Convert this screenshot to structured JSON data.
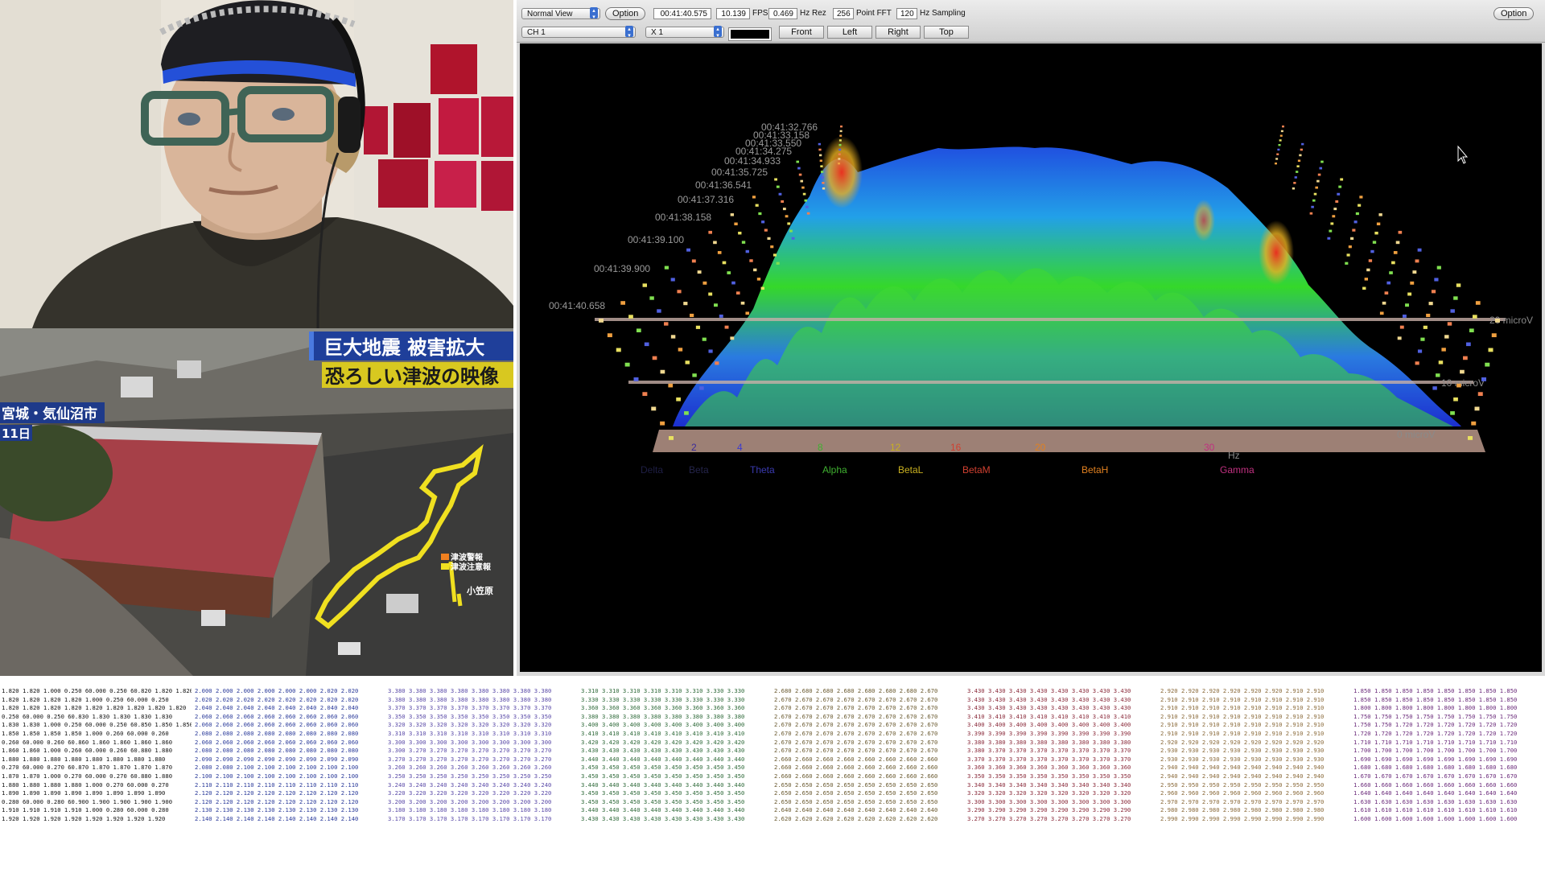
{
  "toolbar": {
    "view_select": "Normal View",
    "option_left": "Option",
    "time_value": "00:41:40.575",
    "fps_value": "10.139",
    "fps_label": "FPS",
    "hzrez_value": "0.469",
    "hzrez_label": "Hz Rez",
    "fft_value": "256",
    "fft_label": "Point FFT",
    "sampling_value": "120",
    "sampling_label": "Hz Sampling",
    "option_right": "Option",
    "channel_select": "CH 1",
    "scale_select": "X 1",
    "view_buttons": [
      "Front",
      "Left",
      "Right",
      "Top"
    ]
  },
  "plot": {
    "timestamps": [
      "00:41:40.658",
      "00:41:39.900",
      "00:41:39.100",
      "00:41:38.158",
      "00:41:37.316",
      "00:41:36.541",
      "00:41:35.725",
      "00:41:34.933",
      "00:41:34.275",
      "00:41:33.550",
      "00:41:33.158",
      "00:41:32.766"
    ],
    "amplitude_labels": [
      "20 microV",
      "10 microV",
      "0 microV"
    ],
    "freq_ticks": [
      "2",
      "4",
      "8",
      "12",
      "16",
      "20",
      "30"
    ],
    "hz_label": "Hz",
    "bands": [
      "Delta",
      "Beta",
      "Theta",
      "Alpha",
      "BetaL",
      "BetaM",
      "BetaH",
      "Gamma"
    ],
    "colors": {
      "surface_low": "#1a3fd8",
      "surface_mid": "#33dd22",
      "surface_high": "#e8221a"
    }
  },
  "tv": {
    "headline1": "巨大地震 被害拡大",
    "headline2": "恐ろしい津波の映像",
    "location": "宮城・気仙沼市",
    "date": "11日",
    "legend1": "津波警報",
    "legend2": "津波注意報",
    "map_label": "小笠原"
  },
  "data_table": {
    "columns": [
      {
        "color": "#111111",
        "rows": [
          "1.820 1.820 1.000 0.250 60.000 0.250 60.820 1.820 1.820",
          "1.820 1.820 1.820 1.820 1.000 0.250 60.000 0.250",
          "1.820 1.820 1.820 1.820 1.820 1.820 1.820 1.820 1.820",
          "0.250 60.000 0.250 60.830 1.830 1.830 1.830 1.830",
          "1.830 1.830 1.000 0.250 60.000 0.250 60.850 1.850 1.850",
          "1.850 1.850 1.850 1.850 1.000 0.260 60.000 0.260",
          "0.260 60.000 0.260 60.860 1.860 1.860 1.860 1.860",
          "1.860 1.860 1.000 0.260 60.000 0.260 60.880 1.880",
          "1.880 1.880 1.880 1.880 1.880 1.880 1.880 1.880",
          "0.270 60.000 0.270 60.870 1.870 1.870 1.870 1.870",
          "1.870 1.870 1.000 0.270 60.000 0.270 60.880 1.880",
          "1.880 1.880 1.880 1.880 1.000 0.270 60.000 0.270",
          "1.890 1.890 1.890 1.890 1.890 1.890 1.890 1.890",
          "0.280 60.000 0.280 60.900 1.900 1.900 1.900 1.900",
          "1.910 1.910 1.910 1.910 1.000 0.280 60.000 0.280",
          "1.920 1.920 1.920 1.920 1.920 1.920 1.920 1.920"
        ]
      },
      {
        "color": "#2a3a9a",
        "rows": [
          "2.000 2.000 2.000 2.000 2.000 2.000 2.020 2.020",
          "2.020 2.020 2.020 2.020 2.020 2.020 2.020 2.020",
          "2.040 2.040 2.040 2.040 2.040 2.040 2.040 2.040",
          "2.060 2.060 2.060 2.060 2.060 2.060 2.060 2.060",
          "2.060 2.060 2.060 2.060 2.060 2.060 2.060 2.060",
          "2.080 2.080 2.080 2.080 2.080 2.080 2.080 2.080",
          "2.060 2.060 2.060 2.060 2.060 2.060 2.060 2.060",
          "2.080 2.080 2.080 2.080 2.080 2.080 2.080 2.080",
          "2.090 2.090 2.090 2.090 2.090 2.090 2.090 2.090",
          "2.080 2.080 2.100 2.100 2.100 2.100 2.100 2.100",
          "2.100 2.100 2.100 2.100 2.100 2.100 2.100 2.100",
          "2.110 2.110 2.110 2.110 2.110 2.110 2.110 2.110",
          "2.120 2.120 2.120 2.120 2.120 2.120 2.120 2.120",
          "2.120 2.120 2.120 2.120 2.120 2.120 2.120 2.120",
          "2.130 2.130 2.130 2.130 2.130 2.130 2.130 2.130",
          "2.140 2.140 2.140 2.140 2.140 2.140 2.140 2.140"
        ]
      },
      {
        "color": "#5a4aa8",
        "rows": [
          "3.380 3.380 3.380 3.380 3.380 3.380 3.380 3.380",
          "3.380 3.380 3.380 3.380 3.380 3.380 3.380 3.380",
          "3.370 3.370 3.370 3.370 3.370 3.370 3.370 3.370",
          "3.350 3.350 3.350 3.350 3.350 3.350 3.350 3.350",
          "3.320 3.320 3.320 3.320 3.320 3.320 3.320 3.320",
          "3.310 3.310 3.310 3.310 3.310 3.310 3.310 3.310",
          "3.300 3.300 3.300 3.300 3.300 3.300 3.300 3.300",
          "3.300 3.270 3.270 3.270 3.270 3.270 3.270 3.270",
          "3.270 3.270 3.270 3.270 3.270 3.270 3.270 3.270",
          "3.260 3.260 3.260 3.260 3.260 3.260 3.260 3.260",
          "3.250 3.250 3.250 3.250 3.250 3.250 3.250 3.250",
          "3.240 3.240 3.240 3.240 3.240 3.240 3.240 3.240",
          "3.220 3.220 3.220 3.220 3.220 3.220 3.220 3.220",
          "3.200 3.200 3.200 3.200 3.200 3.200 3.200 3.200",
          "3.180 3.180 3.180 3.180 3.180 3.180 3.180 3.180",
          "3.170 3.170 3.170 3.170 3.170 3.170 3.170 3.170"
        ]
      },
      {
        "color": "#2f6a3a",
        "rows": [
          "3.310 3.310 3.310 3.310 3.310 3.310 3.330 3.330",
          "3.330 3.330 3.330 3.330 3.330 3.330 3.330 3.330",
          "3.360 3.360 3.360 3.360 3.360 3.360 3.360 3.360",
          "3.380 3.380 3.380 3.380 3.380 3.380 3.380 3.380",
          "3.400 3.400 3.400 3.400 3.400 3.400 3.400 3.400",
          "3.410 3.410 3.410 3.410 3.410 3.410 3.410 3.410",
          "3.420 3.420 3.420 3.420 3.420 3.420 3.420 3.420",
          "3.430 3.430 3.430 3.430 3.430 3.430 3.430 3.430",
          "3.440 3.440 3.440 3.440 3.440 3.440 3.440 3.440",
          "3.450 3.450 3.450 3.450 3.450 3.450 3.450 3.450",
          "3.450 3.450 3.450 3.450 3.450 3.450 3.450 3.450",
          "3.440 3.440 3.440 3.440 3.440 3.440 3.440 3.440",
          "3.450 3.450 3.450 3.450 3.450 3.450 3.450 3.450",
          "3.450 3.450 3.450 3.450 3.450 3.450 3.450 3.450",
          "3.440 3.440 3.440 3.440 3.440 3.440 3.440 3.440",
          "3.430 3.430 3.430 3.430 3.430 3.430 3.430 3.430"
        ]
      },
      {
        "color": "#6a5a30",
        "rows": [
          "2.680 2.680 2.680 2.680 2.680 2.680 2.680 2.670",
          "2.670 2.670 2.670 2.670 2.670 2.670 2.670 2.670",
          "2.670 2.670 2.670 2.670 2.670 2.670 2.670 2.670",
          "2.670 2.670 2.670 2.670 2.670 2.670 2.670 2.670",
          "2.670 2.670 2.670 2.670 2.670 2.670 2.670 2.670",
          "2.670 2.670 2.670 2.670 2.670 2.670 2.670 2.670",
          "2.670 2.670 2.670 2.670 2.670 2.670 2.670 2.670",
          "2.670 2.670 2.670 2.670 2.670 2.670 2.670 2.670",
          "2.660 2.660 2.660 2.660 2.660 2.660 2.660 2.660",
          "2.660 2.660 2.660 2.660 2.660 2.660 2.660 2.660",
          "2.660 2.660 2.660 2.660 2.660 2.660 2.660 2.660",
          "2.650 2.650 2.650 2.650 2.650 2.650 2.650 2.650",
          "2.650 2.650 2.650 2.650 2.650 2.650 2.650 2.650",
          "2.650 2.650 2.650 2.650 2.650 2.650 2.650 2.650",
          "2.640 2.640 2.640 2.640 2.640 2.640 2.640 2.640",
          "2.620 2.620 2.620 2.620 2.620 2.620 2.620 2.620"
        ]
      },
      {
        "color": "#8a2a3a",
        "rows": [
          "3.430 3.430 3.430 3.430 3.430 3.430 3.430 3.430",
          "3.430 3.430 3.430 3.430 3.430 3.430 3.430 3.430",
          "3.430 3.430 3.430 3.430 3.430 3.430 3.430 3.430",
          "3.410 3.410 3.410 3.410 3.410 3.410 3.410 3.410",
          "3.400 3.400 3.400 3.400 3.400 3.400 3.400 3.400",
          "3.390 3.390 3.390 3.390 3.390 3.390 3.390 3.390",
          "3.380 3.380 3.380 3.380 3.380 3.380 3.380 3.380",
          "3.380 3.370 3.370 3.370 3.370 3.370 3.370 3.370",
          "3.370 3.370 3.370 3.370 3.370 3.370 3.370 3.370",
          "3.360 3.360 3.360 3.360 3.360 3.360 3.360 3.360",
          "3.350 3.350 3.350 3.350 3.350 3.350 3.350 3.350",
          "3.340 3.340 3.340 3.340 3.340 3.340 3.340 3.340",
          "3.320 3.320 3.320 3.320 3.320 3.320 3.320 3.320",
          "3.300 3.300 3.300 3.300 3.300 3.300 3.300 3.300",
          "3.290 3.290 3.290 3.290 3.290 3.290 3.290 3.290",
          "3.270 3.270 3.270 3.270 3.270 3.270 3.270 3.270"
        ]
      },
      {
        "color": "#8a6a3a",
        "rows": [
          "2.920 2.920 2.920 2.920 2.920 2.920 2.910 2.910",
          "2.910 2.910 2.910 2.910 2.910 2.910 2.910 2.910",
          "2.910 2.910 2.910 2.910 2.910 2.910 2.910 2.910",
          "2.910 2.910 2.910 2.910 2.910 2.910 2.910 2.910",
          "2.910 2.910 2.910 2.910 2.910 2.910 2.910 2.910",
          "2.910 2.910 2.910 2.910 2.910 2.910 2.910 2.910",
          "2.920 2.920 2.920 2.920 2.920 2.920 2.920 2.920",
          "2.930 2.930 2.930 2.930 2.930 2.930 2.930 2.930",
          "2.930 2.930 2.930 2.930 2.930 2.930 2.930 2.930",
          "2.940 2.940 2.940 2.940 2.940 2.940 2.940 2.940",
          "2.940 2.940 2.940 2.940 2.940 2.940 2.940 2.940",
          "2.950 2.950 2.950 2.950 2.950 2.950 2.950 2.950",
          "2.960 2.960 2.960 2.960 2.960 2.960 2.960 2.960",
          "2.970 2.970 2.970 2.970 2.970 2.970 2.970 2.970",
          "2.980 2.980 2.980 2.980 2.980 2.980 2.980 2.980",
          "2.990 2.990 2.990 2.990 2.990 2.990 2.990 2.990"
        ]
      },
      {
        "color": "#6a2a7a",
        "rows": [
          "1.850 1.850 1.850 1.850 1.850 1.850 1.850 1.850",
          "1.850 1.850 1.850 1.850 1.850 1.850 1.850 1.850",
          "1.800 1.800 1.800 1.800 1.800 1.800 1.800 1.800",
          "1.750 1.750 1.750 1.750 1.750 1.750 1.750 1.750",
          "1.750 1.750 1.720 1.720 1.720 1.720 1.720 1.720",
          "1.720 1.720 1.720 1.720 1.720 1.720 1.720 1.720",
          "1.710 1.710 1.710 1.710 1.710 1.710 1.710 1.710",
          "1.700 1.700 1.700 1.700 1.700 1.700 1.700 1.700",
          "1.690 1.690 1.690 1.690 1.690 1.690 1.690 1.690",
          "1.680 1.680 1.680 1.680 1.680 1.680 1.680 1.680",
          "1.670 1.670 1.670 1.670 1.670 1.670 1.670 1.670",
          "1.660 1.660 1.660 1.660 1.660 1.660 1.660 1.660",
          "1.640 1.640 1.640 1.640 1.640 1.640 1.640 1.640",
          "1.630 1.630 1.630 1.630 1.630 1.630 1.630 1.630",
          "1.610 1.610 1.610 1.610 1.610 1.610 1.610 1.610",
          "1.600 1.600 1.600 1.600 1.600 1.600 1.600 1.600"
        ]
      }
    ]
  }
}
